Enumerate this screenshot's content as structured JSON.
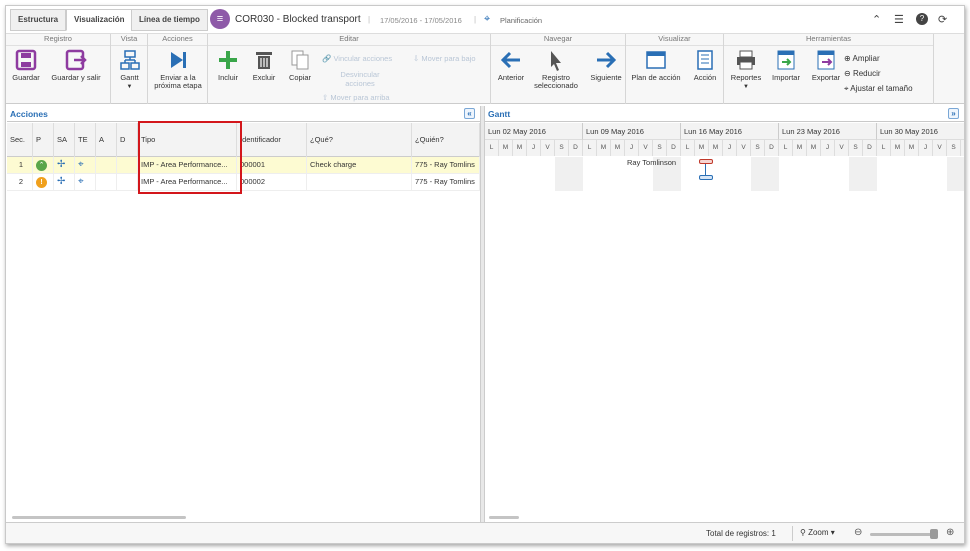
{
  "tabs": [
    "Estructura",
    "Visualización",
    "Línea de tiempo"
  ],
  "document": {
    "title": "COR030 - Blocked transport",
    "dates": "17/05/2016 - 17/05/2016",
    "planning_label": "Planificación"
  },
  "ribbon": {
    "groups": {
      "registro": "Registro",
      "vista": "Vista",
      "acciones": "Acciones",
      "editar": "Editar",
      "navegar": "Navegar",
      "visualizar": "Visualizar",
      "herramientas": "Herramientas"
    },
    "buttons": {
      "guardar": "Guardar",
      "guardar_salir": "Guardar y salir",
      "gantt": "Gantt",
      "enviar": "Enviar a la",
      "enviar2": "próxima etapa",
      "incluir": "Incluir",
      "excluir": "Excluir",
      "copiar": "Copiar",
      "vincular": "Vincular acciones",
      "desvincular": "Desvincular",
      "desvincular2": "acciones",
      "mover_abajo": "Mover para bajo",
      "mover_arriba": "Mover para arriba",
      "anterior": "Anterior",
      "registro_sel": "Registro",
      "registro_sel2": "seleccionado",
      "siguiente": "Siguiente",
      "plan_accion": "Plan de acción",
      "accion": "Acción",
      "reportes": "Reportes",
      "importar": "Importar",
      "exportar": "Exportar",
      "ampliar": "Ampliar",
      "reducir": "Reducir",
      "ajustar": "Ajustar el tamaño"
    }
  },
  "acciones": {
    "title": "Acciones",
    "columns": [
      "Sec.",
      "P",
      "SA",
      "TE",
      "A",
      "D",
      "Tipo",
      "Identificador",
      "¿Qué?",
      "¿Quién?"
    ],
    "rows": [
      {
        "sec": "1",
        "p_color": "#5aa64a",
        "tipo": "IMP - Area Performance...",
        "id": "000001",
        "que": "Check charge",
        "quien": "775 - Ray Tomlins"
      },
      {
        "sec": "2",
        "p_color": "#f0a01c",
        "tipo": "IMP - Area Performance...",
        "id": "000002",
        "que": "",
        "quien": "775 - Ray Tomlins"
      }
    ]
  },
  "gantt": {
    "title": "Gantt",
    "weeks": [
      "Lun 02 May 2016",
      "Lun 09 May 2016",
      "Lun 16 May 2016",
      "Lun 23 May 2016",
      "Lun 30 May 2016"
    ],
    "days": [
      "L",
      "M",
      "M",
      "J",
      "V",
      "S",
      "D"
    ],
    "resource_label": "Ray Tomlinson"
  },
  "status": {
    "total": "Total de registros: 1",
    "zoom": "Zoom"
  }
}
